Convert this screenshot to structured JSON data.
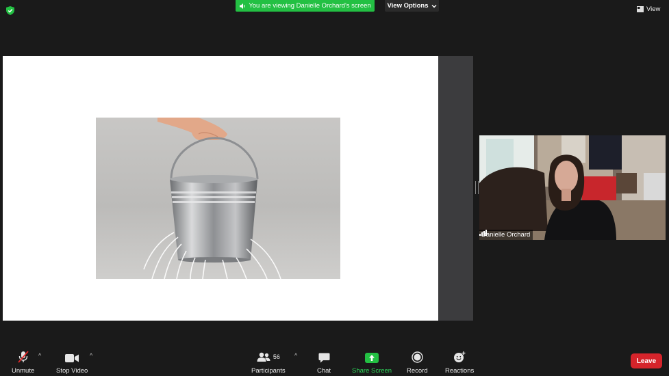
{
  "top": {
    "banner_text": "You are viewing Danielle Orchard's screen",
    "view_options_label": "View Options",
    "view_label": "View"
  },
  "participant_tile": {
    "name": "Danielle Orchard"
  },
  "toolbar": {
    "unmute_label": "Unmute",
    "stop_video_label": "Stop Video",
    "participants_label": "Participants",
    "participants_count": "56",
    "chat_label": "Chat",
    "share_screen_label": "Share Screen",
    "record_label": "Record",
    "reactions_label": "Reactions",
    "leave_label": "Leave"
  },
  "colors": {
    "banner_green": "#23c043",
    "share_green": "#2ed65a",
    "leave_red": "#d5242b",
    "background": "#1a1a1a"
  },
  "icons": [
    "shield-check-icon",
    "speaker-icon",
    "chevron-down-icon",
    "gallery-view-icon",
    "mic-muted-icon",
    "video-camera-icon",
    "participants-icon",
    "chat-bubble-icon",
    "share-screen-icon",
    "record-icon",
    "reactions-icon",
    "signal-bars-icon"
  ]
}
